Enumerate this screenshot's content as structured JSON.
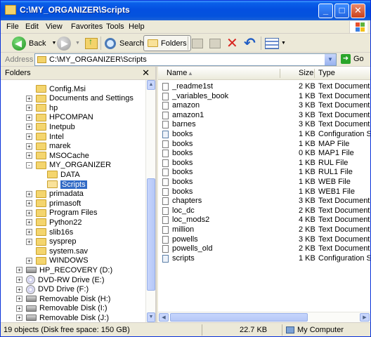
{
  "window": {
    "title": "C:\\MY_ORGANIZER\\Scripts"
  },
  "menu": [
    "File",
    "Edit",
    "View",
    "Favorites",
    "Tools",
    "Help"
  ],
  "toolbar": {
    "back_label": "Back",
    "search_label": "Search",
    "folders_label": "Folders"
  },
  "address": {
    "label": "Address",
    "value": "C:\\MY_ORGANIZER\\Scripts",
    "go_label": "Go"
  },
  "folders_pane": {
    "title": "Folders",
    "tree": [
      {
        "label": "Config.Msi",
        "kind": "folder",
        "expander": ""
      },
      {
        "label": "Documents and Settings",
        "kind": "folder",
        "expander": "+"
      },
      {
        "label": "hp",
        "kind": "folder",
        "expander": "+"
      },
      {
        "label": "HPCOMPAN",
        "kind": "folder",
        "expander": "+"
      },
      {
        "label": "Inetpub",
        "kind": "folder",
        "expander": "+"
      },
      {
        "label": "Intel",
        "kind": "folder",
        "expander": "+"
      },
      {
        "label": "marek",
        "kind": "folder",
        "expander": "+"
      },
      {
        "label": "MSOCache",
        "kind": "folder",
        "expander": "+"
      },
      {
        "label": "MY_ORGANIZER",
        "kind": "folder",
        "expander": "-"
      },
      {
        "label": "DATA",
        "kind": "folder",
        "expander": ""
      },
      {
        "label": "Scripts",
        "kind": "folder-open",
        "expander": "",
        "selected": true
      },
      {
        "label": "primadata",
        "kind": "folder",
        "expander": "+"
      },
      {
        "label": "primasoft",
        "kind": "folder",
        "expander": "+"
      },
      {
        "label": "Program Files",
        "kind": "folder",
        "expander": "+"
      },
      {
        "label": "Python22",
        "kind": "folder",
        "expander": "+"
      },
      {
        "label": "slib16s",
        "kind": "folder",
        "expander": "+"
      },
      {
        "label": "sysprep",
        "kind": "folder",
        "expander": "+"
      },
      {
        "label": "system.sav",
        "kind": "folder",
        "expander": ""
      },
      {
        "label": "WINDOWS",
        "kind": "folder",
        "expander": "+"
      },
      {
        "label": "HP_RECOVERY (D:)",
        "kind": "drive",
        "expander": "+"
      },
      {
        "label": "DVD-RW Drive (E:)",
        "kind": "cd",
        "expander": "+"
      },
      {
        "label": "DVD Drive (F:)",
        "kind": "cd",
        "expander": "+"
      },
      {
        "label": "Removable Disk (H:)",
        "kind": "drive",
        "expander": "+"
      },
      {
        "label": "Removable Disk (I:)",
        "kind": "drive",
        "expander": "+"
      },
      {
        "label": "Removable Disk (J:)",
        "kind": "drive",
        "expander": "+"
      }
    ]
  },
  "files": {
    "columns": {
      "name": "Name",
      "size": "Size",
      "type": "Type"
    },
    "rows": [
      {
        "name": "_readme1st",
        "size": "2 KB",
        "type": "Text Document",
        "icon": "text"
      },
      {
        "name": "_variables_book",
        "size": "1 KB",
        "type": "Text Document",
        "icon": "text"
      },
      {
        "name": "amazon",
        "size": "3 KB",
        "type": "Text Document",
        "icon": "text"
      },
      {
        "name": "amazon1",
        "size": "3 KB",
        "type": "Text Document",
        "icon": "text"
      },
      {
        "name": "barnes",
        "size": "3 KB",
        "type": "Text Document",
        "icon": "text"
      },
      {
        "name": "books",
        "size": "1 KB",
        "type": "Configuration Setti",
        "icon": "cfg"
      },
      {
        "name": "books",
        "size": "1 KB",
        "type": "MAP File",
        "icon": "file"
      },
      {
        "name": "books",
        "size": "0 KB",
        "type": "MAP1 File",
        "icon": "file"
      },
      {
        "name": "books",
        "size": "1 KB",
        "type": "RUL File",
        "icon": "file"
      },
      {
        "name": "books",
        "size": "1 KB",
        "type": "RUL1 File",
        "icon": "file"
      },
      {
        "name": "books",
        "size": "1 KB",
        "type": "WEB File",
        "icon": "file"
      },
      {
        "name": "books",
        "size": "1 KB",
        "type": "WEB1 File",
        "icon": "file"
      },
      {
        "name": "chapters",
        "size": "3 KB",
        "type": "Text Document",
        "icon": "text"
      },
      {
        "name": "loc_dc",
        "size": "2 KB",
        "type": "Text Document",
        "icon": "text"
      },
      {
        "name": "loc_mods2",
        "size": "4 KB",
        "type": "Text Document",
        "icon": "text"
      },
      {
        "name": "million",
        "size": "2 KB",
        "type": "Text Document",
        "icon": "text"
      },
      {
        "name": "powells",
        "size": "3 KB",
        "type": "Text Document",
        "icon": "text"
      },
      {
        "name": "powells_old",
        "size": "2 KB",
        "type": "Text Document",
        "icon": "text"
      },
      {
        "name": "scripts",
        "size": "1 KB",
        "type": "Configuration Setti",
        "icon": "cfg"
      }
    ]
  },
  "status": {
    "objects": "19 objects (Disk free space: 150 GB)",
    "size": "22.7 KB",
    "location": "My Computer"
  }
}
